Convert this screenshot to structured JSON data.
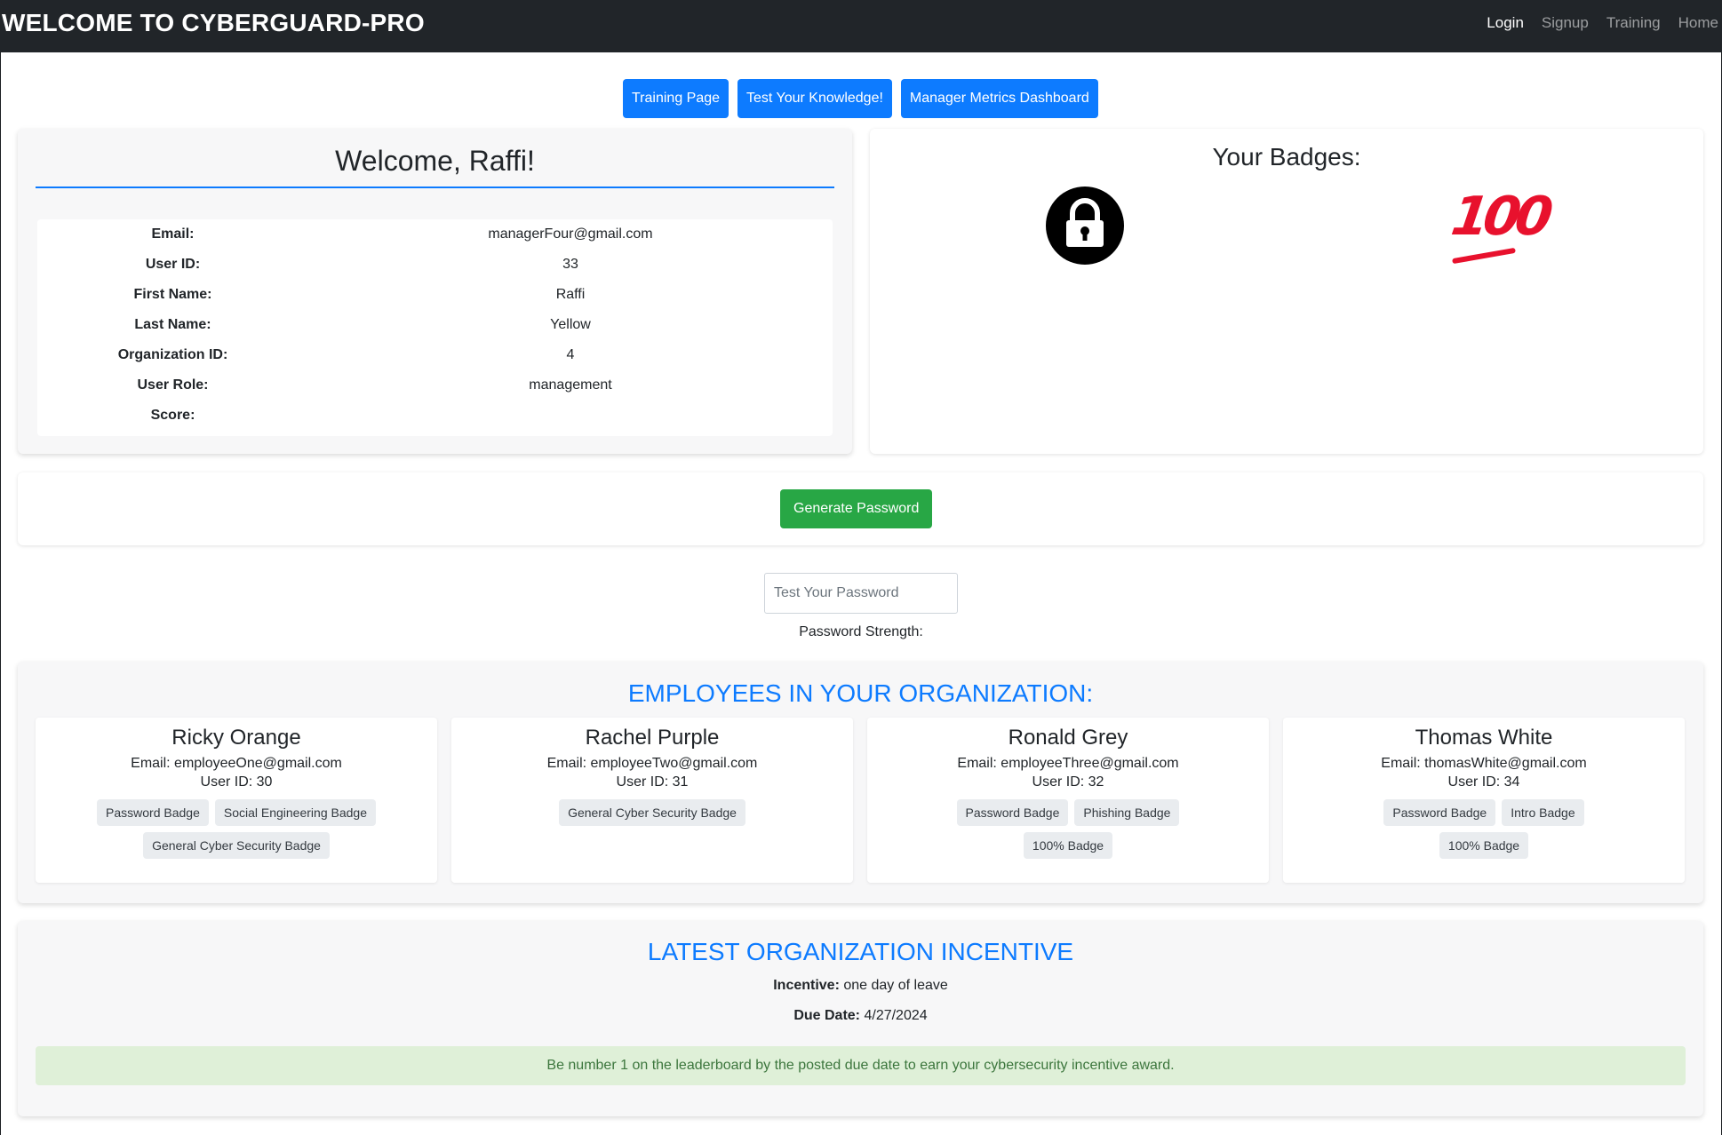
{
  "navbar": {
    "brand": "WELCOME TO CYBERGUARD-PRO",
    "links": [
      "Login",
      "Signup",
      "Training",
      "Home"
    ]
  },
  "actions": {
    "training_page": "Training Page",
    "test_knowledge": "Test Your Knowledge!",
    "manager_dashboard": "Manager Metrics Dashboard"
  },
  "profile": {
    "heading": "Welcome, Raffi!",
    "fields": [
      {
        "label": "Email:",
        "value": "managerFour@gmail.com"
      },
      {
        "label": "User ID:",
        "value": "33"
      },
      {
        "label": "First Name:",
        "value": "Raffi"
      },
      {
        "label": "Last Name:",
        "value": "Yellow"
      },
      {
        "label": "Organization ID:",
        "value": "4"
      },
      {
        "label": "User Role:",
        "value": "management"
      },
      {
        "label": "Score:",
        "value": ""
      }
    ]
  },
  "badges": {
    "heading": "Your Badges:",
    "icons": [
      "lock-icon",
      "hundred-points-icon"
    ],
    "hundred_text": "100"
  },
  "password": {
    "generate_label": "Generate Password",
    "test_placeholder": "Test Your Password",
    "strength_label": "Password Strength:"
  },
  "employees": {
    "heading": "EMPLOYEES IN YOUR ORGANIZATION:",
    "list": [
      {
        "name": "Ricky Orange",
        "email": "Email: employeeOne@gmail.com",
        "user_id": "User ID: 30",
        "badges": [
          "Password Badge",
          "Social Engineering Badge",
          "General Cyber Security Badge"
        ]
      },
      {
        "name": "Rachel Purple",
        "email": "Email: employeeTwo@gmail.com",
        "user_id": "User ID: 31",
        "badges": [
          "General Cyber Security Badge"
        ]
      },
      {
        "name": "Ronald Grey",
        "email": "Email: employeeThree@gmail.com",
        "user_id": "User ID: 32",
        "badges": [
          "Password Badge",
          "Phishing Badge",
          "100% Badge"
        ]
      },
      {
        "name": "Thomas White",
        "email": "Email: thomasWhite@gmail.com",
        "user_id": "User ID: 34",
        "badges": [
          "Password Badge",
          "Intro Badge",
          "100% Badge"
        ]
      }
    ]
  },
  "incentive": {
    "heading": "LATEST ORGANIZATION INCENTIVE",
    "incentive_label": "Incentive:",
    "incentive_value": "one day of leave",
    "due_label": "Due Date:",
    "due_value": "4/27/2024",
    "alert": "Be number 1 on the leaderboard by the posted due date to earn your cybersecurity incentive award."
  },
  "colors": {
    "navbar": "#212529",
    "primary": "#0d7bff",
    "success": "#28a745",
    "alert_bg": "#dff0d8",
    "alert_text": "#3c763d",
    "hundred_red": "#e8112d"
  }
}
